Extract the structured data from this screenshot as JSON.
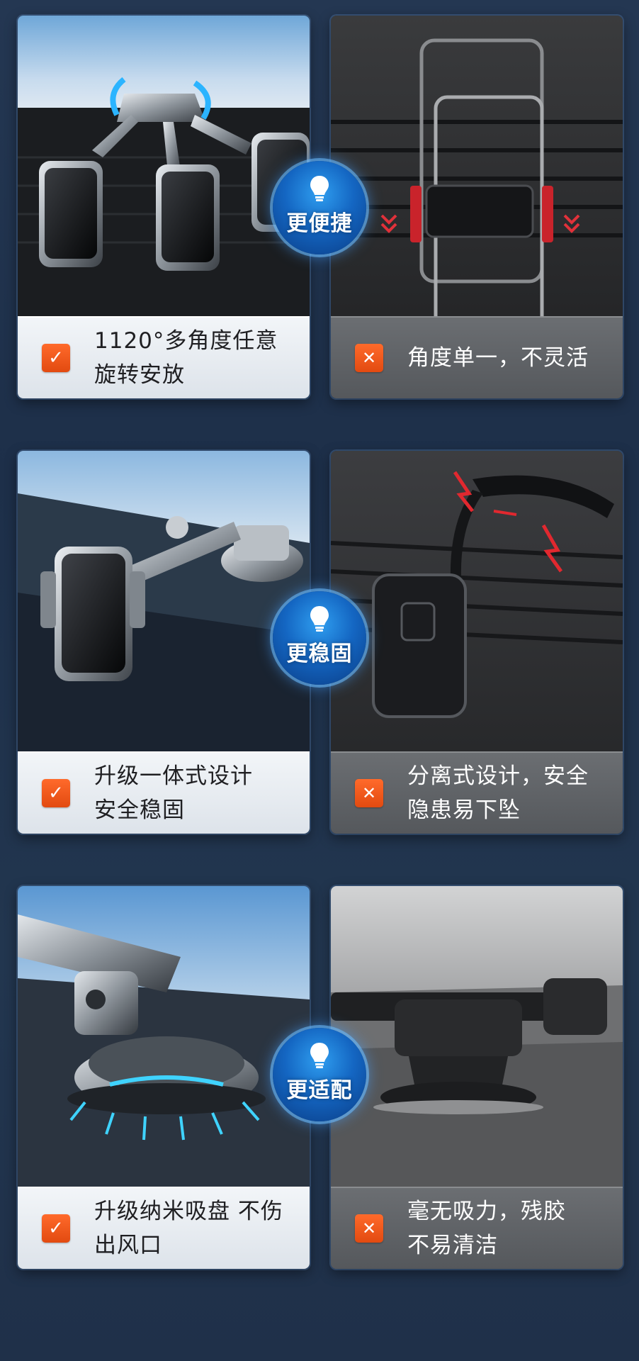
{
  "comparisons": [
    {
      "badge": "更便捷",
      "good": {
        "icon": "check-icon",
        "text": "1120°多角度任意\n旋转安放"
      },
      "bad": {
        "icon": "x-icon",
        "text": "角度单一，不灵活"
      }
    },
    {
      "badge": "更稳固",
      "good": {
        "icon": "check-icon",
        "text": "升级一体式设计\n安全稳固"
      },
      "bad": {
        "icon": "x-icon",
        "text": "分离式设计，安全\n隐患易下坠"
      }
    },
    {
      "badge": "更适配",
      "good": {
        "icon": "check-icon",
        "text": "升级纳米吸盘 不伤\n出风口"
      },
      "bad": {
        "icon": "x-icon",
        "text": "毫无吸力，残胶\n不易清洁"
      }
    }
  ],
  "colors": {
    "accent_orange": "#ff5a1f",
    "badge_blue": "#1466c2",
    "background": "#22364f"
  }
}
